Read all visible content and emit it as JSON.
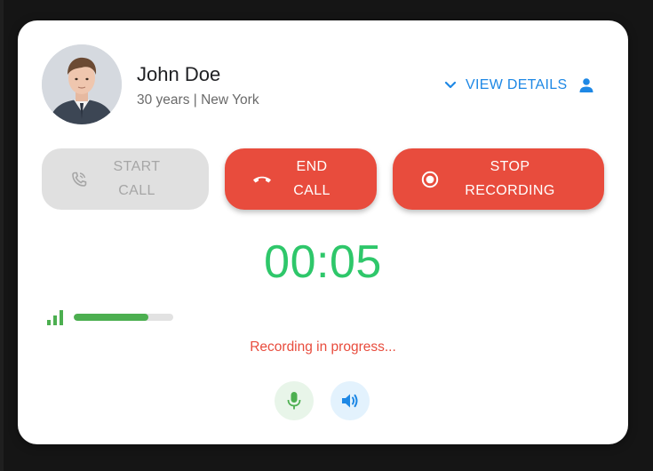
{
  "contact": {
    "name": "John Doe",
    "details": "30 years | New York"
  },
  "header": {
    "view_details_label": "VIEW DETAILS",
    "icons": [
      "chevron-down-icon",
      "person-icon"
    ]
  },
  "buttons": {
    "start_call": {
      "line1": "START",
      "line2": "CALL",
      "enabled": false,
      "icon": "phone-icon"
    },
    "end_call": {
      "line1": "END",
      "line2": "CALL",
      "enabled": true,
      "icon": "hang-up-icon"
    },
    "stop_recording": {
      "line1": "STOP",
      "line2": "RECORDING",
      "enabled": true,
      "icon": "record-icon"
    }
  },
  "call": {
    "timer": "00:05",
    "signal_level_fraction": 0.75,
    "status_text": "Recording in progress..."
  },
  "controls": {
    "icons": [
      "microphone-icon",
      "speaker-icon"
    ]
  },
  "colors": {
    "accent_blue": "#1e88e5",
    "danger_red": "#e84c3d",
    "success_green": "#2ec76a",
    "signal_green": "#4caf50",
    "disabled_gray": "#e0e0e0"
  }
}
